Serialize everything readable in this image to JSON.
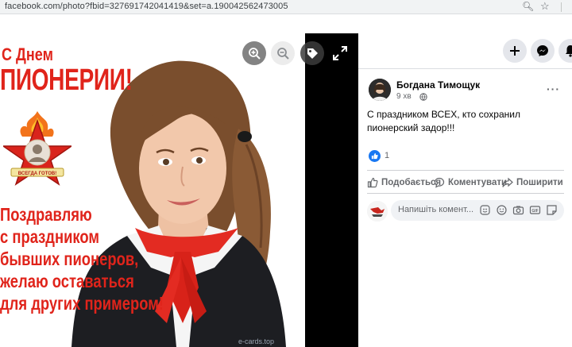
{
  "browser": {
    "url": "facebook.com/photo?fbid=327691742041419&set=a.190042562473005",
    "zoom_icon": "magnifier-icon",
    "bookmark_icon": "star-icon"
  },
  "photo": {
    "heading_line1": "С Днем",
    "heading_line2": "ПИОНЕРИИ!",
    "greeting": [
      "Поздравляю",
      "с праздником",
      "бывших пионеров,",
      "желаю оставаться",
      "для других примером!"
    ],
    "badge_text": "ВСЕГДА ГОТОВ!",
    "watermark": "e-cards.top",
    "controls": [
      "zoom-in-icon",
      "zoom-out-icon",
      "tag-icon",
      "fullscreen-icon"
    ]
  },
  "header_buttons": [
    "plus-icon",
    "messenger-icon",
    "notifications-icon"
  ],
  "post": {
    "author": "Богдана Тимощук",
    "time": "9 хв",
    "text": "С праздником ВСЕХ, кто сохранил пионерский задор!!!",
    "like_count": "1",
    "actions": {
      "like": "Подобається",
      "comment": "Коментувати",
      "share": "Поширити"
    },
    "comment_placeholder": "Напишіть комент..."
  },
  "colors": {
    "accent": "#1877f2",
    "poster_red": "#e0241b"
  }
}
